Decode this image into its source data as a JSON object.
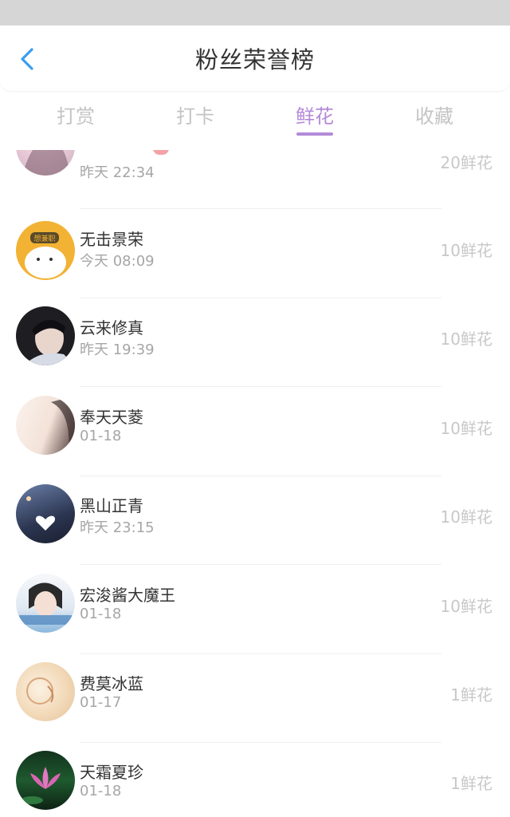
{
  "header": {
    "title": "粉丝荣誉榜",
    "back_icon": "chevron-left-icon",
    "back_color": "#3a9ef0"
  },
  "tabs": [
    {
      "label": "打赏",
      "active": false
    },
    {
      "label": "打卡",
      "active": false
    },
    {
      "label": "鲜花",
      "active": true
    },
    {
      "label": "收藏",
      "active": false
    }
  ],
  "accent_color": "#b48ad8",
  "fans": [
    {
      "name": "",
      "time": "昨天 22:34",
      "amount": "20鲜花"
    },
    {
      "name": "无击景荣",
      "time": "今天 08:09",
      "amount": "10鲜花"
    },
    {
      "name": "云来修真",
      "time": "昨天 19:39",
      "amount": "10鲜花"
    },
    {
      "name": "奉天天菱",
      "time": "01-18",
      "amount": "10鲜花"
    },
    {
      "name": "黑山正青",
      "time": "昨天 23:15",
      "amount": "10鲜花"
    },
    {
      "name": "宏浚酱大魔王",
      "time": "01-18",
      "amount": "10鲜花"
    },
    {
      "name": "费莫冰蓝",
      "time": "01-17",
      "amount": "1鲜花"
    },
    {
      "name": "天霜夏珍",
      "time": "01-18",
      "amount": "1鲜花"
    }
  ]
}
